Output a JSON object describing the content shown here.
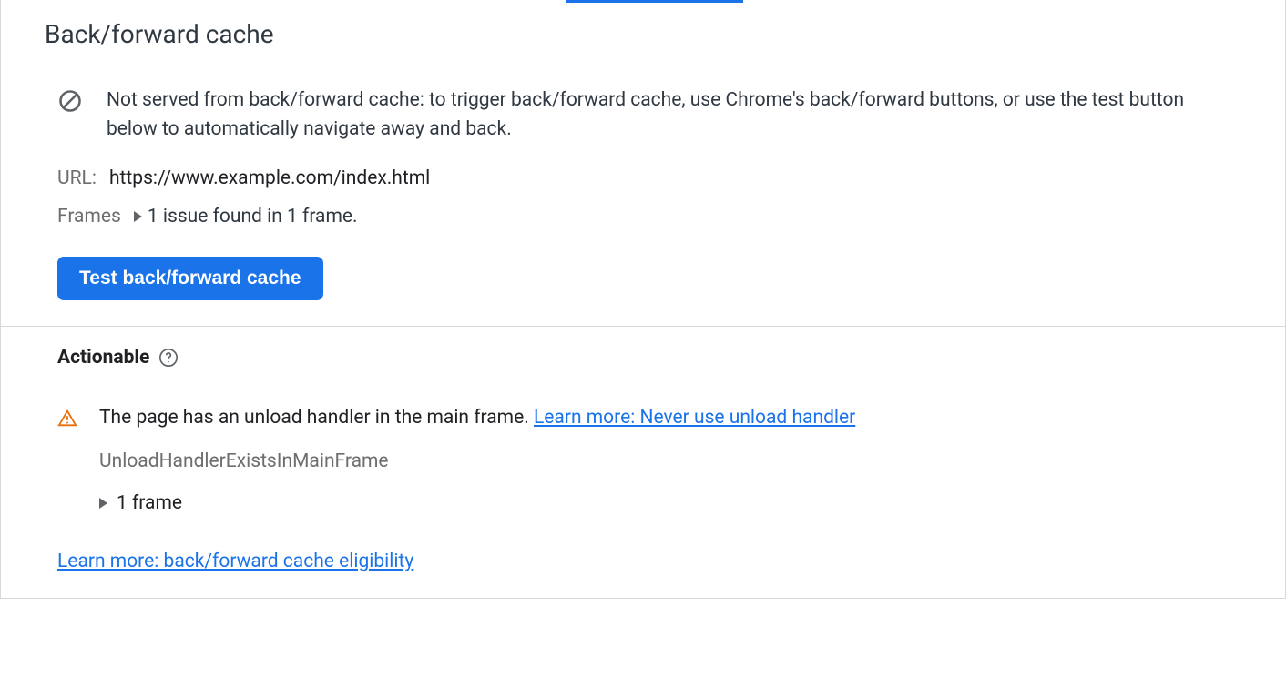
{
  "header": {
    "title": "Back/forward cache"
  },
  "info": {
    "message": "Not served from back/forward cache: to trigger back/forward cache, use Chrome's back/forward buttons, or use the test button below to automatically navigate away and back."
  },
  "meta": {
    "url_label": "URL:",
    "url_value": "https://www.example.com/index.html",
    "frames_label": "Frames",
    "frames_summary": "1 issue found in 1 frame."
  },
  "actions": {
    "test_button": "Test back/forward cache"
  },
  "actionable": {
    "title": "Actionable",
    "issue_text": "The page has an unload handler in the main frame. ",
    "issue_link": "Learn more: Never use unload handler",
    "issue_id": "UnloadHandlerExistsInMainFrame",
    "frame_count": "1 frame",
    "bottom_link": "Learn more: back/forward cache eligibility"
  }
}
